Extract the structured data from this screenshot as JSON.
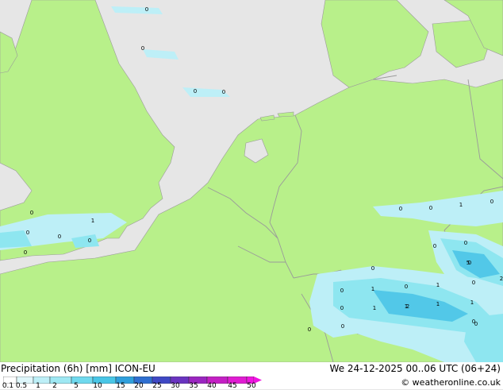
{
  "title": "Precipitation (6h) [mm] ICON-EU",
  "timestamp": "We 24-12-2025 00..06 UTC (06+24)",
  "credit": "© weatheronline.co.uk",
  "colors": {
    "sea": "#e6e6e6",
    "land": "#b8f08a",
    "border": "#9a9a9a",
    "precip_light": "#bdeff7",
    "precip_mid": "#8ee6f0",
    "precip_heavy": "#52c8e8"
  },
  "legend": {
    "ticks": [
      "0.1",
      "0.5",
      "1",
      "2",
      "5",
      "10",
      "15",
      "20",
      "25",
      "30",
      "35",
      "40",
      "45",
      "50"
    ],
    "colors": [
      "#ffffff",
      "#dff7fb",
      "#bdeff7",
      "#9ee8f3",
      "#6fd9ee",
      "#49c6e6",
      "#2f9fdc",
      "#2f6fd0",
      "#3f48c4",
      "#6a34c0",
      "#9a26c0",
      "#c420c4",
      "#e01cd2",
      "#f014e0"
    ]
  },
  "point_labels": [
    {
      "text": "0"
    },
    {
      "text": "0"
    },
    {
      "text": "0"
    },
    {
      "text": "0"
    },
    {
      "text": "0"
    },
    {
      "text": "1"
    },
    {
      "text": "0"
    },
    {
      "text": "0"
    },
    {
      "text": "0"
    },
    {
      "text": "0"
    },
    {
      "text": "0"
    },
    {
      "text": "0"
    },
    {
      "text": "0"
    },
    {
      "text": "0"
    },
    {
      "text": "1"
    },
    {
      "text": "0"
    },
    {
      "text": "0"
    },
    {
      "text": "0"
    },
    {
      "text": "5"
    },
    {
      "text": "2"
    },
    {
      "text": "0"
    },
    {
      "text": "1"
    },
    {
      "text": "0"
    },
    {
      "text": "1"
    },
    {
      "text": "0"
    },
    {
      "text": "1"
    },
    {
      "text": "1"
    },
    {
      "text": "2"
    },
    {
      "text": "1"
    },
    {
      "text": "1"
    },
    {
      "text": "0"
    },
    {
      "text": "0"
    },
    {
      "text": "0"
    },
    {
      "text": "0"
    },
    {
      "text": "0"
    }
  ]
}
